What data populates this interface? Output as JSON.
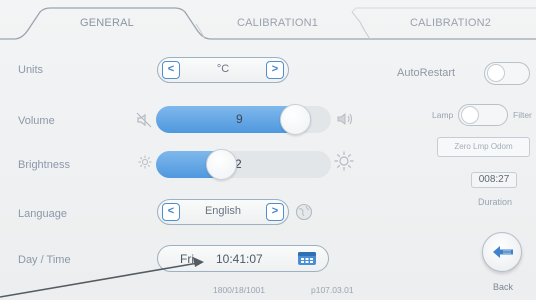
{
  "tabs": [
    {
      "label": "GENERAL",
      "active": true
    },
    {
      "label": "CALIBRATION1",
      "active": false
    },
    {
      "label": "CALIBRATION2",
      "active": false
    }
  ],
  "units": {
    "label": "Units",
    "value": "°C"
  },
  "volume": {
    "label": "Volume",
    "value": "9",
    "level": 0.86
  },
  "brightness": {
    "label": "Brightness",
    "value": "2",
    "level": 0.35
  },
  "language": {
    "label": "Language",
    "value": "English"
  },
  "datetime": {
    "label": "Day / Time",
    "day": "Fri",
    "time": "10:41:07"
  },
  "right_panel": {
    "autorestart_label": "AutoRestart",
    "lamp_label": "Lamp",
    "filter_label": "Filter",
    "zero_label": "Zero Lmp Odom",
    "duration_value": "008:27",
    "duration_label": "Duration",
    "back_label": "Back"
  },
  "footer": {
    "version_left": "1800/18/1001",
    "version_right": "p107.03.01"
  },
  "colors": {
    "accent": "#5a9fe2",
    "button_border": "#4f8fcf"
  }
}
